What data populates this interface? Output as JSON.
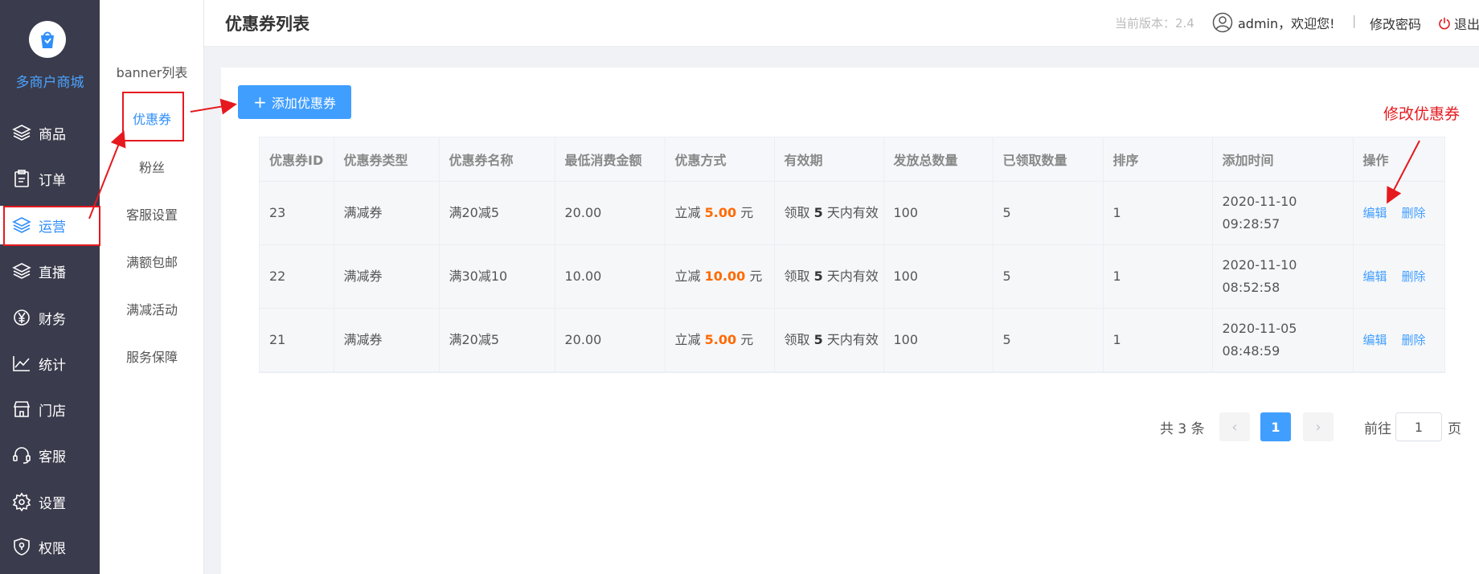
{
  "brand": {
    "name": "多商户商城",
    "accent": "#409eff"
  },
  "sidebar": {
    "items": [
      {
        "label": "商品",
        "icon": "layers-icon"
      },
      {
        "label": "订单",
        "icon": "clipboard-icon"
      },
      {
        "label": "运营",
        "icon": "layers-icon",
        "active": true
      },
      {
        "label": "直播",
        "icon": "layers-icon"
      },
      {
        "label": "财务",
        "icon": "yen-icon"
      },
      {
        "label": "统计",
        "icon": "line-chart-icon"
      },
      {
        "label": "门店",
        "icon": "store-icon"
      },
      {
        "label": "客服",
        "icon": "headset-icon"
      },
      {
        "label": "设置",
        "icon": "gear-icon"
      },
      {
        "label": "权限",
        "icon": "shield-icon"
      }
    ]
  },
  "subnav": {
    "items": [
      {
        "label": "banner列表"
      },
      {
        "label": "优惠券",
        "active": true
      },
      {
        "label": "粉丝"
      },
      {
        "label": "客服设置"
      },
      {
        "label": "满额包邮"
      },
      {
        "label": "满减活动"
      },
      {
        "label": "服务保障"
      }
    ]
  },
  "header": {
    "title": "优惠券列表",
    "version": "当前版本：2.4",
    "user": "admin，欢迎您!",
    "separator": "|",
    "change_password": "修改密码",
    "logout": "退出"
  },
  "toolbar": {
    "add_label": "添加优惠券"
  },
  "table": {
    "columns": [
      "优惠券ID",
      "优惠券类型",
      "优惠券名称",
      "最低消费金额",
      "优惠方式",
      "有效期",
      "发放总数量",
      "已领取数量",
      "排序",
      "添加时间",
      "操作"
    ],
    "rows": [
      {
        "id": "23",
        "type": "满减券",
        "name": "满20减5",
        "min": "20.00",
        "method_prefix": "立减",
        "amount": "5.00",
        "method_suffix": "元",
        "valid_prefix": "领取",
        "valid_days": "5",
        "valid_suffix": "天内有效",
        "total": "100",
        "received": "5",
        "sort": "1",
        "time": "2020-11-10 09:28:57",
        "edit": "编辑",
        "delete": "删除"
      },
      {
        "id": "22",
        "type": "满减券",
        "name": "满30减10",
        "min": "10.00",
        "method_prefix": "立减",
        "amount": "10.00",
        "method_suffix": "元",
        "valid_prefix": "领取",
        "valid_days": "5",
        "valid_suffix": "天内有效",
        "total": "100",
        "received": "5",
        "sort": "1",
        "time": "2020-11-10 08:52:58",
        "edit": "编辑",
        "delete": "删除"
      },
      {
        "id": "21",
        "type": "满减券",
        "name": "满20减5",
        "min": "20.00",
        "method_prefix": "立减",
        "amount": "5.00",
        "method_suffix": "元",
        "valid_prefix": "领取",
        "valid_days": "5",
        "valid_suffix": "天内有效",
        "total": "100",
        "received": "5",
        "sort": "1",
        "time": "2020-11-05 08:48:59",
        "edit": "编辑",
        "delete": "删除"
      }
    ]
  },
  "pagination": {
    "total": "共 3 条",
    "prev": "‹",
    "current": "1",
    "next": "›",
    "goto_label": "前往",
    "goto_value": "1",
    "page_suffix": "页"
  },
  "annotation": {
    "text": "修改优惠券",
    "color": "#e5191e"
  }
}
